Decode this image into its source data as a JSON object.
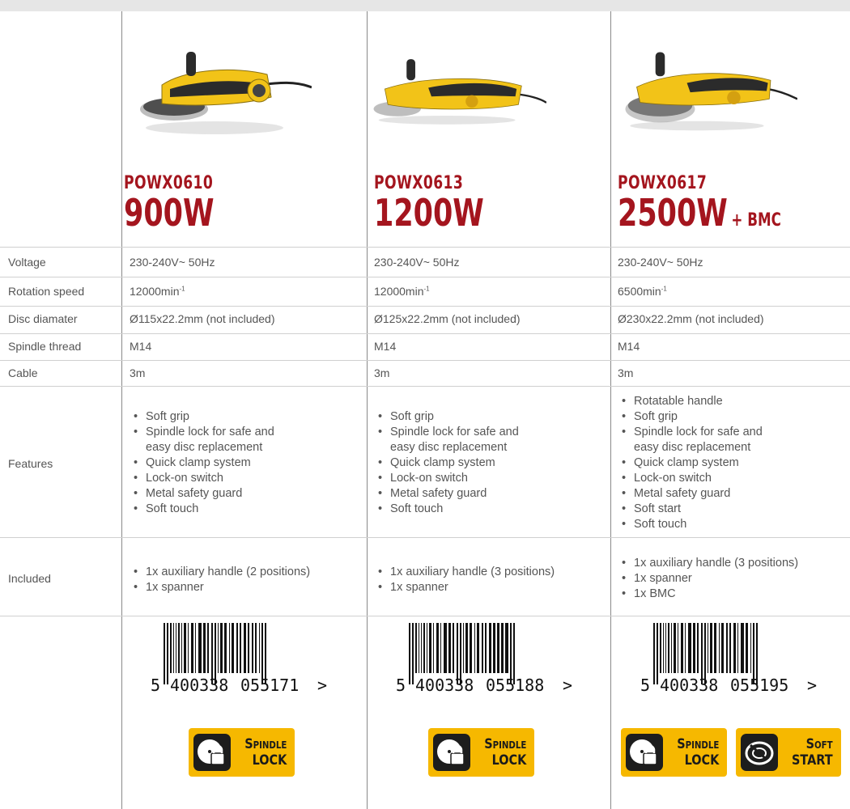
{
  "row_labels": {
    "voltage": "Voltage",
    "rotation_speed": "Rotation speed",
    "disc_diameter": "Disc diamater",
    "spindle_thread": "Spindle thread",
    "cable": "Cable",
    "features": "Features",
    "included": "Included"
  },
  "products": [
    {
      "model": "POWX0610",
      "power": "900W",
      "power_suffix": "",
      "voltage": "230-240V~ 50Hz",
      "speed": "12000min",
      "speed_unit": "-1",
      "disc": "Ø115x22.2mm (not included)",
      "thread": "M14",
      "cable": "3m",
      "features": [
        "Soft grip",
        "Spindle lock for safe and",
        "easy disc replacement",
        "Quick clamp system",
        "Lock-on switch",
        "Metal safety guard",
        "Soft touch"
      ],
      "included": [
        "1x auxiliary handle (2 positions)",
        "1x spanner"
      ],
      "barcode": {
        "first": "5",
        "left": "400338",
        "right": "055171",
        "end": ">"
      },
      "badges": [
        {
          "line1": "Spindle",
          "line2": "LOCK",
          "icon": "spindle-lock-icon"
        }
      ]
    },
    {
      "model": "POWX0613",
      "power": "1200W",
      "power_suffix": "",
      "voltage": "230-240V~ 50Hz",
      "speed": "12000min",
      "speed_unit": "-1",
      "disc": "Ø125x22.2mm (not included)",
      "thread": "M14",
      "cable": "3m",
      "features": [
        "Soft grip",
        "Spindle lock for safe and",
        "easy disc replacement",
        "Quick clamp system",
        "Lock-on switch",
        "Metal safety guard",
        "Soft touch"
      ],
      "included": [
        "1x auxiliary handle (3 positions)",
        "1x spanner"
      ],
      "barcode": {
        "first": "5",
        "left": "400338",
        "right": "055188",
        "end": ">"
      },
      "badges": [
        {
          "line1": "Spindle",
          "line2": "LOCK",
          "icon": "spindle-lock-icon"
        }
      ]
    },
    {
      "model": "POWX0617",
      "power": "2500W",
      "power_suffix": "+ BMC",
      "voltage": "230-240V~ 50Hz",
      "speed": "6500min",
      "speed_unit": "-1",
      "disc": "Ø230x22.2mm (not included)",
      "thread": "M14",
      "cable": "3m",
      "features": [
        "Rotatable handle",
        "Soft grip",
        "Spindle lock for safe and",
        "easy disc replacement",
        "Quick clamp system",
        "Lock-on switch",
        "Metal safety guard",
        "Soft start",
        "Soft touch"
      ],
      "included": [
        "1x auxiliary handle (3 positions)",
        "1x spanner",
        "1x BMC"
      ],
      "barcode": {
        "first": "5",
        "left": "400338",
        "right": "055195",
        "end": ">"
      },
      "badges": [
        {
          "line1": "Spindle",
          "line2": "LOCK",
          "icon": "spindle-lock-icon"
        },
        {
          "line1": "Soft",
          "line2": "START",
          "icon": "soft-start-icon"
        }
      ]
    }
  ],
  "colors": {
    "model_red": "#a4151e",
    "badge_yellow": "#f6b800",
    "tool_yellow": "#f2c318"
  }
}
